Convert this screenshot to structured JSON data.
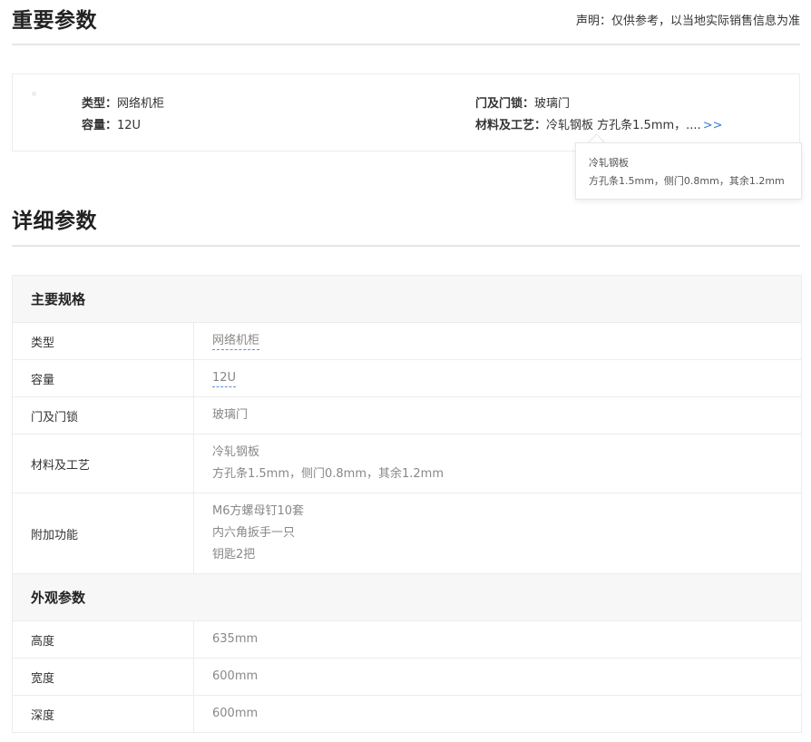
{
  "key_params": {
    "title": "重要参数",
    "disclaimer": "声明：仅供参考，以当地实际销售信息为准",
    "items": [
      {
        "label": "类型：",
        "value": "网络机柜"
      },
      {
        "label": "容量：",
        "value": "12U"
      },
      {
        "label": "门及门锁：",
        "value": "玻璃门"
      },
      {
        "label": "材料及工艺：",
        "value": "冷轧钢板 方孔条1.5mm，...."
      }
    ],
    "more_link": ">>"
  },
  "tooltip": {
    "line1": "冷轧钢板",
    "line2": "方孔条1.5mm，侧门0.8mm，其余1.2mm"
  },
  "detail": {
    "title": "详细参数",
    "sections": [
      {
        "name": "主要规格",
        "rows": [
          {
            "key": "类型",
            "values": [
              "网络机柜"
            ]
          },
          {
            "key": "容量",
            "values": [
              "12U"
            ]
          },
          {
            "key": "门及门锁",
            "values": [
              "玻璃门"
            ]
          },
          {
            "key": "材料及工艺",
            "values": [
              "冷轧钢板",
              "方孔条1.5mm，侧门0.8mm，其余1.2mm"
            ]
          },
          {
            "key": "附加功能",
            "values": [
              "M6方螺母钉10套",
              "内六角扳手一只",
              "钥匙2把"
            ]
          }
        ]
      },
      {
        "name": "外观参数",
        "rows": [
          {
            "key": "高度",
            "values": [
              "635mm"
            ]
          },
          {
            "key": "宽度",
            "values": [
              "600mm"
            ]
          },
          {
            "key": "深度",
            "values": [
              "600mm"
            ]
          }
        ]
      }
    ]
  }
}
